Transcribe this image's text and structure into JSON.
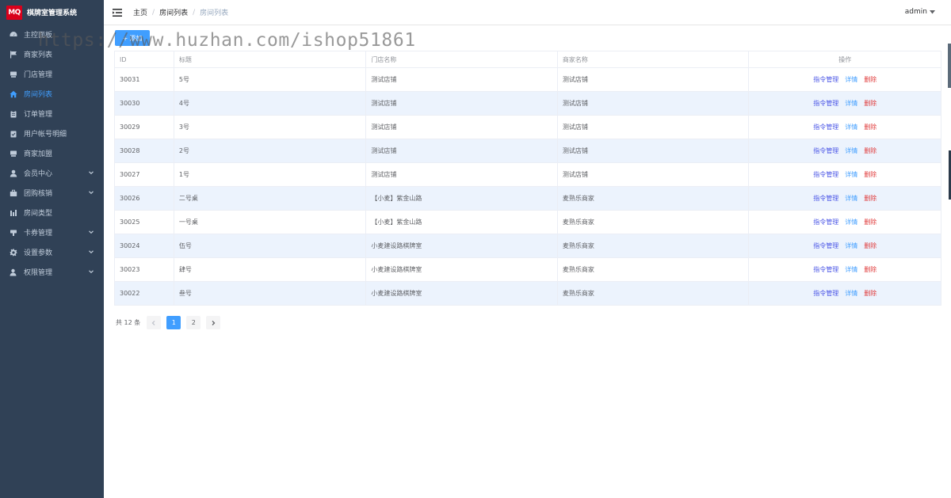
{
  "brand": {
    "logo": "MQ",
    "title": "棋牌室管理系统"
  },
  "sidebar": {
    "items": [
      {
        "label": "主控面板",
        "icon": "dashboard-icon",
        "active": false,
        "expandable": false
      },
      {
        "label": "商家列表",
        "icon": "flag-icon",
        "active": false,
        "expandable": false
      },
      {
        "label": "门店管理",
        "icon": "store-icon",
        "active": false,
        "expandable": false
      },
      {
        "label": "房间列表",
        "icon": "home-icon",
        "active": true,
        "expandable": false
      },
      {
        "label": "订单管理",
        "icon": "clipboard-icon",
        "active": false,
        "expandable": false
      },
      {
        "label": "用户帐号明细",
        "icon": "clipboard-check-icon",
        "active": false,
        "expandable": false
      },
      {
        "label": "商家加盟",
        "icon": "store-icon",
        "active": false,
        "expandable": false
      },
      {
        "label": "会员中心",
        "icon": "user-icon",
        "active": false,
        "expandable": true
      },
      {
        "label": "团购核销",
        "icon": "briefcase-icon",
        "active": false,
        "expandable": true
      },
      {
        "label": "房间类型",
        "icon": "bar-chart-icon",
        "active": false,
        "expandable": false
      },
      {
        "label": "卡券管理",
        "icon": "coupon-icon",
        "active": false,
        "expandable": true
      },
      {
        "label": "设置参数",
        "icon": "gear-icon",
        "active": false,
        "expandable": true
      },
      {
        "label": "权限管理",
        "icon": "user-shield-icon",
        "active": false,
        "expandable": true
      }
    ]
  },
  "header": {
    "breadcrumbs": [
      "主页",
      "房间列表",
      "房间列表"
    ],
    "user": "admin"
  },
  "toolbar": {
    "add_label": "添加"
  },
  "watermark": "https://www.huzhan.com/ishop51861",
  "table": {
    "columns": [
      "ID",
      "标题",
      "门店名称",
      "商家名称",
      "操作"
    ],
    "actions": {
      "command": "指令管理",
      "detail": "详情",
      "delete": "删除"
    },
    "rows": [
      [
        "30031",
        "5号",
        "测试店铺",
        "测试店铺"
      ],
      [
        "30030",
        "4号",
        "测试店铺",
        "测试店铺"
      ],
      [
        "30029",
        "3号",
        "测试店铺",
        "测试店铺"
      ],
      [
        "30028",
        "2号",
        "测试店铺",
        "测试店铺"
      ],
      [
        "30027",
        "1号",
        "测试店铺",
        "测试店铺"
      ],
      [
        "30026",
        "二号桌",
        "【小麦】紫金山路",
        "麦熟乐商家"
      ],
      [
        "30025",
        "一号桌",
        "【小麦】紫金山路",
        "麦熟乐商家"
      ],
      [
        "30024",
        "伍号",
        "小麦建设路棋牌室",
        "麦熟乐商家"
      ],
      [
        "30023",
        "肆号",
        "小麦建设路棋牌室",
        "麦熟乐商家"
      ],
      [
        "30022",
        "叁号",
        "小麦建设路棋牌室",
        "麦熟乐商家"
      ]
    ]
  },
  "pagination": {
    "total_text": "共 12 条",
    "pages": [
      "1",
      "2"
    ],
    "current": "1"
  },
  "colors": {
    "sidebar_bg": "#304156",
    "sidebar_text": "#bfcbd9",
    "accent": "#409eff",
    "brand_red": "#d9001b",
    "stripe": "#ecf3fd",
    "danger": "#e03c3c",
    "command": "#4a55e6"
  }
}
